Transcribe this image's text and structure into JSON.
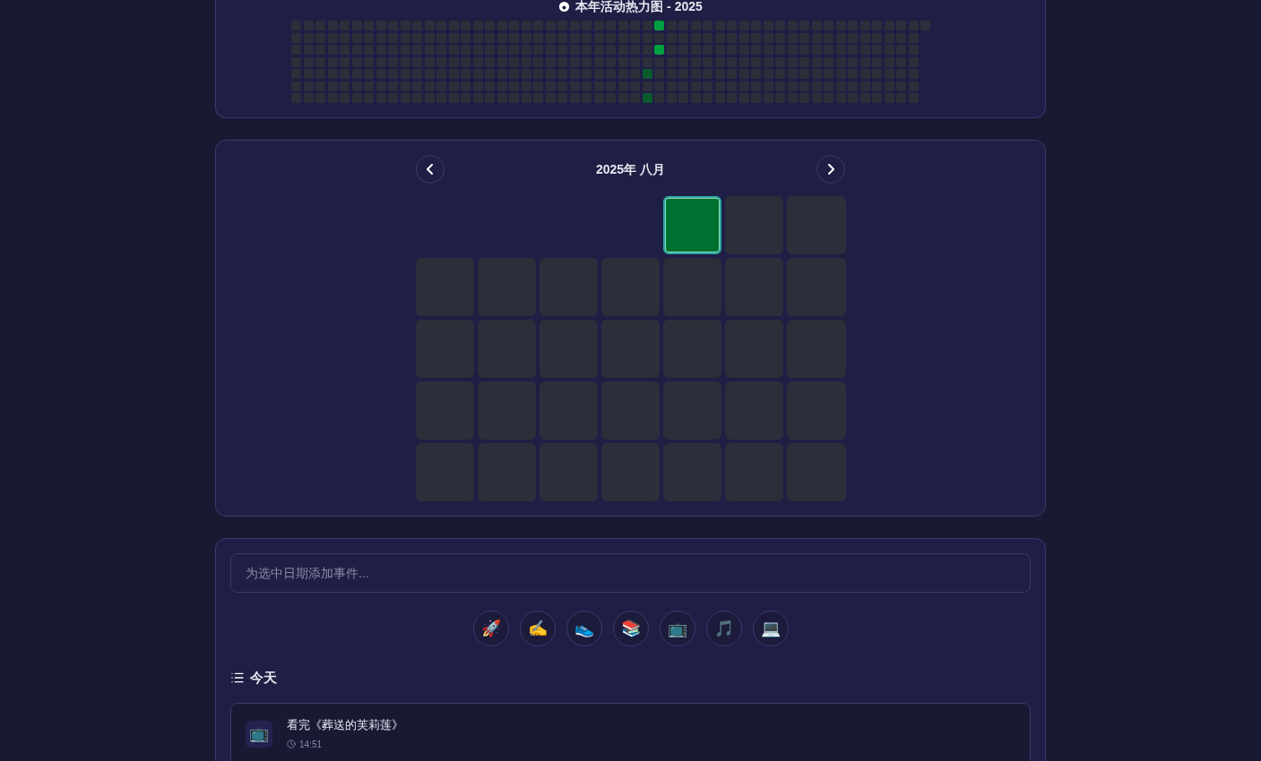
{
  "heatmap": {
    "title": "本年活动热力图 - 2025",
    "weeks": [
      {
        "days": [
          {
            "color": "#2c2f3a"
          },
          {
            "color": "#2c2f3a"
          },
          {
            "color": "#2c2f3a"
          },
          {
            "color": "#2c2f3a"
          },
          {
            "color": "#2c2f3a"
          },
          {
            "color": "#2c2f3a"
          },
          {
            "color": "#2c2f3a"
          }
        ]
      },
      {
        "days": [
          {
            "color": "#2c2f3a"
          },
          {
            "color": "#2c2f3a"
          },
          {
            "color": "#2c2f3a"
          },
          {
            "color": "#2c2f3a"
          },
          {
            "color": "#2c2f3a"
          },
          {
            "color": "#2c2f3a"
          },
          {
            "color": "#2c2f3a"
          }
        ]
      },
      {
        "days": [
          {
            "color": "#2c2f3a"
          },
          {
            "color": "#2c2f3a"
          },
          {
            "color": "#2c2f3a"
          },
          {
            "color": "#2c2f3a"
          },
          {
            "color": "#2c2f3a"
          },
          {
            "color": "#2c2f3a"
          },
          {
            "color": "#2c2f3a"
          }
        ]
      },
      {
        "days": [
          {
            "color": "#2c2f3a"
          },
          {
            "color": "#2c2f3a"
          },
          {
            "color": "#2c2f3a"
          },
          {
            "color": "#2c2f3a"
          },
          {
            "color": "#2c2f3a"
          },
          {
            "color": "#2c2f3a"
          },
          {
            "color": "#2c2f3a"
          }
        ]
      },
      {
        "days": [
          {
            "color": "#2c2f3a"
          },
          {
            "color": "#2c2f3a"
          },
          {
            "color": "#2c2f3a"
          },
          {
            "color": "#2c2f3a"
          },
          {
            "color": "#2c2f3a"
          },
          {
            "color": "#2c2f3a"
          },
          {
            "color": "#2c2f3a"
          }
        ]
      },
      {
        "days": [
          {
            "color": "#2c2f3a"
          },
          {
            "color": "#2c2f3a"
          },
          {
            "color": "#2c2f3a"
          },
          {
            "color": "#2c2f3a"
          },
          {
            "color": "#2c2f3a"
          },
          {
            "color": "#2c2f3a"
          },
          {
            "color": "#2c2f3a"
          }
        ]
      },
      {
        "days": [
          {
            "color": "#2c2f3a"
          },
          {
            "color": "#2c2f3a"
          },
          {
            "color": "#2c2f3a"
          },
          {
            "color": "#2c2f3a"
          },
          {
            "color": "#2c2f3a"
          },
          {
            "color": "#2c2f3a"
          },
          {
            "color": "#2c2f3a"
          }
        ]
      },
      {
        "days": [
          {
            "color": "#2c2f3a"
          },
          {
            "color": "#2c2f3a"
          },
          {
            "color": "#2c2f3a"
          },
          {
            "color": "#2c2f3a"
          },
          {
            "color": "#2c2f3a"
          },
          {
            "color": "#2c2f3a"
          },
          {
            "color": "#2c2f3a"
          }
        ]
      },
      {
        "days": [
          {
            "color": "#2c2f3a"
          },
          {
            "color": "#2c2f3a"
          },
          {
            "color": "#2c2f3a"
          },
          {
            "color": "#2c2f3a"
          },
          {
            "color": "#2c2f3a"
          },
          {
            "color": "#2c2f3a"
          },
          {
            "color": "#2c2f3a"
          }
        ]
      },
      {
        "days": [
          {
            "color": "#2c2f3a"
          },
          {
            "color": "#2c2f3a"
          },
          {
            "color": "#2c2f3a"
          },
          {
            "color": "#2c2f3a"
          },
          {
            "color": "#2c2f3a"
          },
          {
            "color": "#2c2f3a"
          },
          {
            "color": "#2c2f3a"
          }
        ]
      },
      {
        "days": [
          {
            "color": "#2c2f3a"
          },
          {
            "color": "#2c2f3a"
          },
          {
            "color": "#2c2f3a"
          },
          {
            "color": "#2c2f3a"
          },
          {
            "color": "#2c2f3a"
          },
          {
            "color": "#2c2f3a"
          },
          {
            "color": "#2c2f3a"
          }
        ]
      },
      {
        "days": [
          {
            "color": "#2c2f3a"
          },
          {
            "color": "#2c2f3a"
          },
          {
            "color": "#2c2f3a"
          },
          {
            "color": "#2c2f3a"
          },
          {
            "color": "#2c2f3a"
          },
          {
            "color": "#2c2f3a"
          },
          {
            "color": "#2c2f3a"
          }
        ]
      },
      {
        "days": [
          {
            "color": "#2c2f3a"
          },
          {
            "color": "#2c2f3a"
          },
          {
            "color": "#2c2f3a"
          },
          {
            "color": "#2c2f3a"
          },
          {
            "color": "#2c2f3a"
          },
          {
            "color": "#2c2f3a"
          },
          {
            "color": "#2c2f3a"
          }
        ]
      },
      {
        "days": [
          {
            "color": "#2c2f3a"
          },
          {
            "color": "#2c2f3a"
          },
          {
            "color": "#2c2f3a"
          },
          {
            "color": "#2c2f3a"
          },
          {
            "color": "#2c2f3a"
          },
          {
            "color": "#2c2f3a"
          },
          {
            "color": "#2c2f3a"
          }
        ]
      },
      {
        "days": [
          {
            "color": "#2c2f3a"
          },
          {
            "color": "#2c2f3a"
          },
          {
            "color": "#2c2f3a"
          },
          {
            "color": "#2c2f3a"
          },
          {
            "color": "#2c2f3a"
          },
          {
            "color": "#2c2f3a"
          },
          {
            "color": "#2c2f3a"
          }
        ]
      },
      {
        "days": [
          {
            "color": "#2c2f3a"
          },
          {
            "color": "#2c2f3a"
          },
          {
            "color": "#2c2f3a"
          },
          {
            "color": "#2c2f3a"
          },
          {
            "color": "#2c2f3a"
          },
          {
            "color": "#2c2f3a"
          },
          {
            "color": "#2c2f3a"
          }
        ]
      },
      {
        "days": [
          {
            "color": "#2c2f3a"
          },
          {
            "color": "#2c2f3a"
          },
          {
            "color": "#2c2f3a"
          },
          {
            "color": "#2c2f3a"
          },
          {
            "color": "#2c2f3a"
          },
          {
            "color": "#2c2f3a"
          },
          {
            "color": "#2c2f3a"
          }
        ]
      },
      {
        "days": [
          {
            "color": "#2c2f3a"
          },
          {
            "color": "#2c2f3a"
          },
          {
            "color": "#2c2f3a"
          },
          {
            "color": "#2c2f3a"
          },
          {
            "color": "#2c2f3a"
          },
          {
            "color": "#2c2f3a"
          },
          {
            "color": "#2c2f3a"
          }
        ]
      },
      {
        "days": [
          {
            "color": "#2c2f3a"
          },
          {
            "color": "#2c2f3a"
          },
          {
            "color": "#2c2f3a"
          },
          {
            "color": "#2c2f3a"
          },
          {
            "color": "#2c2f3a"
          },
          {
            "color": "#2c2f3a"
          },
          {
            "color": "#2c2f3a"
          }
        ]
      },
      {
        "days": [
          {
            "color": "#2c2f3a"
          },
          {
            "color": "#2c2f3a"
          },
          {
            "color": "#2c2f3a"
          },
          {
            "color": "#2c2f3a"
          },
          {
            "color": "#2c2f3a"
          },
          {
            "color": "#2c2f3a"
          },
          {
            "color": "#2c2f3a"
          }
        ]
      },
      {
        "days": [
          {
            "color": "#2c2f3a"
          },
          {
            "color": "#2c2f3a"
          },
          {
            "color": "#2c2f3a"
          },
          {
            "color": "#2c2f3a"
          },
          {
            "color": "#2c2f3a"
          },
          {
            "color": "#2c2f3a"
          },
          {
            "color": "#2c2f3a"
          }
        ]
      },
      {
        "days": [
          {
            "color": "#2c2f3a"
          },
          {
            "color": "#2c2f3a"
          },
          {
            "color": "#2c2f3a"
          },
          {
            "color": "#2c2f3a"
          },
          {
            "color": "#2c2f3a"
          },
          {
            "color": "#2c2f3a"
          },
          {
            "color": "#2c2f3a"
          }
        ]
      },
      {
        "days": [
          {
            "color": "#2c2f3a"
          },
          {
            "color": "#2c2f3a"
          },
          {
            "color": "#2c2f3a"
          },
          {
            "color": "#2c2f3a"
          },
          {
            "color": "#2c2f3a"
          },
          {
            "color": "#2c2f3a"
          },
          {
            "color": "#2c2f3a"
          }
        ]
      },
      {
        "days": [
          {
            "color": "#2c2f3a"
          },
          {
            "color": "#2c2f3a"
          },
          {
            "color": "#2c2f3a"
          },
          {
            "color": "#2c2f3a"
          },
          {
            "color": "#2c2f3a"
          },
          {
            "color": "#2c2f3a"
          },
          {
            "color": "#2c2f3a"
          }
        ]
      },
      {
        "days": [
          {
            "color": "#2c2f3a"
          },
          {
            "color": "#2c2f3a"
          },
          {
            "color": "#2c2f3a"
          },
          {
            "color": "#2c2f3a"
          },
          {
            "color": "#2c2f3a"
          },
          {
            "color": "#2c2f3a"
          },
          {
            "color": "#2c2f3a"
          }
        ]
      },
      {
        "days": [
          {
            "color": "#2c2f3a"
          },
          {
            "color": "#2c2f3a"
          },
          {
            "color": "#2c2f3a"
          },
          {
            "color": "#2c2f3a"
          },
          {
            "color": "#2c2f3a"
          },
          {
            "color": "#2c2f3a"
          },
          {
            "color": "#2c2f3a"
          }
        ]
      },
      {
        "days": [
          {
            "color": "#2c2f3a"
          },
          {
            "color": "#2c2f3a"
          },
          {
            "color": "#2c2f3a"
          },
          {
            "color": "#2c2f3a"
          },
          {
            "color": "#2c2f3a"
          },
          {
            "color": "#2c2f3a"
          },
          {
            "color": "#2c2f3a"
          }
        ]
      },
      {
        "days": [
          {
            "color": "#2c2f3a"
          },
          {
            "color": "#2c2f3a"
          },
          {
            "color": "#2c2f3a"
          },
          {
            "color": "#2c2f3a"
          },
          {
            "color": "#2c2f3a"
          },
          {
            "color": "#2c2f3a"
          },
          {
            "color": "#2c2f3a"
          }
        ]
      },
      {
        "days": [
          {
            "color": "#2c2f3a"
          },
          {
            "color": "#2c2f3a"
          },
          {
            "color": "#2c2f3a"
          },
          {
            "color": "#2c2f3a"
          },
          {
            "color": "#2c2f3a"
          },
          {
            "color": "#2c2f3a"
          },
          {
            "color": "#2c2f3a"
          }
        ]
      },
      {
        "days": [
          {
            "color": "#2c2f3a"
          },
          {
            "color": "#2c2f3a"
          },
          {
            "color": "#2c2f3a"
          },
          {
            "color": "#2c2f3a"
          },
          {
            "color": "#0b5a2e"
          },
          {
            "color": "#2c2f3a"
          },
          {
            "color": "#0b5a2e"
          }
        ]
      },
      {
        "days": [
          {
            "color": "#00a040"
          },
          {
            "color": "#2c2f3a"
          },
          {
            "color": "#00a040"
          },
          {
            "color": "#2c2f3a"
          },
          {
            "color": "#2c2f3a"
          },
          {
            "color": "#2c2f3a"
          },
          {
            "color": "#2c2f3a"
          }
        ]
      },
      {
        "days": [
          {
            "color": "#2c2f3a"
          },
          {
            "color": "#2c2f3a"
          },
          {
            "color": "#2c2f3a"
          },
          {
            "color": "#2c2f3a"
          },
          {
            "color": "#2c2f3a"
          },
          {
            "color": "#2c2f3a"
          },
          {
            "color": "#2c2f3a"
          }
        ]
      },
      {
        "days": [
          {
            "color": "#2c2f3a"
          },
          {
            "color": "#2c2f3a"
          },
          {
            "color": "#2c2f3a"
          },
          {
            "color": "#2c2f3a"
          },
          {
            "color": "#2c2f3a"
          },
          {
            "color": "#2c2f3a"
          },
          {
            "color": "#2c2f3a"
          }
        ]
      },
      {
        "days": [
          {
            "color": "#2c2f3a"
          },
          {
            "color": "#2c2f3a"
          },
          {
            "color": "#2c2f3a"
          },
          {
            "color": "#2c2f3a"
          },
          {
            "color": "#2c2f3a"
          },
          {
            "color": "#2c2f3a"
          },
          {
            "color": "#2c2f3a"
          }
        ]
      },
      {
        "days": [
          {
            "color": "#2c2f3a"
          },
          {
            "color": "#2c2f3a"
          },
          {
            "color": "#2c2f3a"
          },
          {
            "color": "#2c2f3a"
          },
          {
            "color": "#2c2f3a"
          },
          {
            "color": "#2c2f3a"
          },
          {
            "color": "#2c2f3a"
          }
        ]
      },
      {
        "days": [
          {
            "color": "#2c2f3a"
          },
          {
            "color": "#2c2f3a"
          },
          {
            "color": "#2c2f3a"
          },
          {
            "color": "#2c2f3a"
          },
          {
            "color": "#2c2f3a"
          },
          {
            "color": "#2c2f3a"
          },
          {
            "color": "#2c2f3a"
          }
        ]
      },
      {
        "days": [
          {
            "color": "#2c2f3a"
          },
          {
            "color": "#2c2f3a"
          },
          {
            "color": "#2c2f3a"
          },
          {
            "color": "#2c2f3a"
          },
          {
            "color": "#2c2f3a"
          },
          {
            "color": "#2c2f3a"
          },
          {
            "color": "#2c2f3a"
          }
        ]
      },
      {
        "days": [
          {
            "color": "#2c2f3a"
          },
          {
            "color": "#2c2f3a"
          },
          {
            "color": "#2c2f3a"
          },
          {
            "color": "#2c2f3a"
          },
          {
            "color": "#2c2f3a"
          },
          {
            "color": "#2c2f3a"
          },
          {
            "color": "#2c2f3a"
          }
        ]
      },
      {
        "days": [
          {
            "color": "#2c2f3a"
          },
          {
            "color": "#2c2f3a"
          },
          {
            "color": "#2c2f3a"
          },
          {
            "color": "#2c2f3a"
          },
          {
            "color": "#2c2f3a"
          },
          {
            "color": "#2c2f3a"
          },
          {
            "color": "#2c2f3a"
          }
        ]
      },
      {
        "days": [
          {
            "color": "#2c2f3a"
          },
          {
            "color": "#2c2f3a"
          },
          {
            "color": "#2c2f3a"
          },
          {
            "color": "#2c2f3a"
          },
          {
            "color": "#2c2f3a"
          },
          {
            "color": "#2c2f3a"
          },
          {
            "color": "#2c2f3a"
          }
        ]
      },
      {
        "days": [
          {
            "color": "#2c2f3a"
          },
          {
            "color": "#2c2f3a"
          },
          {
            "color": "#2c2f3a"
          },
          {
            "color": "#2c2f3a"
          },
          {
            "color": "#2c2f3a"
          },
          {
            "color": "#2c2f3a"
          },
          {
            "color": "#2c2f3a"
          }
        ]
      },
      {
        "days": [
          {
            "color": "#2c2f3a"
          },
          {
            "color": "#2c2f3a"
          },
          {
            "color": "#2c2f3a"
          },
          {
            "color": "#2c2f3a"
          },
          {
            "color": "#2c2f3a"
          },
          {
            "color": "#2c2f3a"
          },
          {
            "color": "#2c2f3a"
          }
        ]
      },
      {
        "days": [
          {
            "color": "#2c2f3a"
          },
          {
            "color": "#2c2f3a"
          },
          {
            "color": "#2c2f3a"
          },
          {
            "color": "#2c2f3a"
          },
          {
            "color": "#2c2f3a"
          },
          {
            "color": "#2c2f3a"
          },
          {
            "color": "#2c2f3a"
          }
        ]
      },
      {
        "days": [
          {
            "color": "#2c2f3a"
          },
          {
            "color": "#2c2f3a"
          },
          {
            "color": "#2c2f3a"
          },
          {
            "color": "#2c2f3a"
          },
          {
            "color": "#2c2f3a"
          },
          {
            "color": "#2c2f3a"
          },
          {
            "color": "#2c2f3a"
          }
        ]
      },
      {
        "days": [
          {
            "color": "#2c2f3a"
          },
          {
            "color": "#2c2f3a"
          },
          {
            "color": "#2c2f3a"
          },
          {
            "color": "#2c2f3a"
          },
          {
            "color": "#2c2f3a"
          },
          {
            "color": "#2c2f3a"
          },
          {
            "color": "#2c2f3a"
          }
        ]
      },
      {
        "days": [
          {
            "color": "#2c2f3a"
          },
          {
            "color": "#2c2f3a"
          },
          {
            "color": "#2c2f3a"
          },
          {
            "color": "#2c2f3a"
          },
          {
            "color": "#2c2f3a"
          },
          {
            "color": "#2c2f3a"
          },
          {
            "color": "#2c2f3a"
          }
        ]
      },
      {
        "days": [
          {
            "color": "#2c2f3a"
          },
          {
            "color": "#2c2f3a"
          },
          {
            "color": "#2c2f3a"
          },
          {
            "color": "#2c2f3a"
          },
          {
            "color": "#2c2f3a"
          },
          {
            "color": "#2c2f3a"
          },
          {
            "color": "#2c2f3a"
          }
        ]
      },
      {
        "days": [
          {
            "color": "#2c2f3a"
          },
          {
            "color": "#2c2f3a"
          },
          {
            "color": "#2c2f3a"
          },
          {
            "color": "#2c2f3a"
          },
          {
            "color": "#2c2f3a"
          },
          {
            "color": "#2c2f3a"
          },
          {
            "color": "#2c2f3a"
          }
        ]
      },
      {
        "days": [
          {
            "color": "#2c2f3a"
          },
          {
            "color": "#2c2f3a"
          },
          {
            "color": "#2c2f3a"
          },
          {
            "color": "#2c2f3a"
          },
          {
            "color": "#2c2f3a"
          },
          {
            "color": "#2c2f3a"
          },
          {
            "color": "#2c2f3a"
          }
        ]
      },
      {
        "days": [
          {
            "color": "#2c2f3a"
          },
          {
            "color": "#2c2f3a"
          },
          {
            "color": "#2c2f3a"
          },
          {
            "color": "#2c2f3a"
          },
          {
            "color": "#2c2f3a"
          },
          {
            "color": "#2c2f3a"
          },
          {
            "color": "#2c2f3a"
          }
        ]
      },
      {
        "days": [
          {
            "color": "#2c2f3a"
          },
          {
            "color": "#2c2f3a"
          },
          {
            "color": "#2c2f3a"
          },
          {
            "color": "#2c2f3a"
          },
          {
            "color": "#2c2f3a"
          },
          {
            "color": "#2c2f3a"
          },
          {
            "color": "#2c2f3a"
          }
        ]
      },
      {
        "days": [
          {
            "color": "#2c2f3a"
          },
          {
            "color": "#2c2f3a"
          },
          {
            "color": "#2c2f3a"
          },
          {
            "color": "#2c2f3a"
          },
          {
            "color": "#2c2f3a"
          },
          {
            "color": "#2c2f3a"
          },
          {
            "color": "#2c2f3a"
          }
        ]
      },
      {
        "days": [
          {
            "color": "#2c2f3a"
          }
        ]
      }
    ]
  },
  "calendar": {
    "title": "2025年 八月",
    "days": [
      {
        "kind": "blank"
      },
      {
        "kind": "blank"
      },
      {
        "kind": "blank"
      },
      {
        "kind": "blank"
      },
      {
        "kind": "day",
        "color": "#007030",
        "selected": true
      },
      {
        "kind": "day",
        "color": "#2c2f3a",
        "selected": false
      },
      {
        "kind": "day",
        "color": "#2c2f3a",
        "selected": false
      },
      {
        "kind": "day",
        "color": "#2c2f3a",
        "selected": false
      },
      {
        "kind": "day",
        "color": "#2c2f3a",
        "selected": false
      },
      {
        "kind": "day",
        "color": "#2c2f3a",
        "selected": false
      },
      {
        "kind": "day",
        "color": "#2c2f3a",
        "selected": false
      },
      {
        "kind": "day",
        "color": "#2c2f3a",
        "selected": false
      },
      {
        "kind": "day",
        "color": "#2c2f3a",
        "selected": false
      },
      {
        "kind": "day",
        "color": "#2c2f3a",
        "selected": false
      },
      {
        "kind": "day",
        "color": "#2c2f3a",
        "selected": false
      },
      {
        "kind": "day",
        "color": "#2c2f3a",
        "selected": false
      },
      {
        "kind": "day",
        "color": "#2c2f3a",
        "selected": false
      },
      {
        "kind": "day",
        "color": "#2c2f3a",
        "selected": false
      },
      {
        "kind": "day",
        "color": "#2c2f3a",
        "selected": false
      },
      {
        "kind": "day",
        "color": "#2c2f3a",
        "selected": false
      },
      {
        "kind": "day",
        "color": "#2c2f3a",
        "selected": false
      },
      {
        "kind": "day",
        "color": "#2c2f3a",
        "selected": false
      },
      {
        "kind": "day",
        "color": "#2c2f3a",
        "selected": false
      },
      {
        "kind": "day",
        "color": "#2c2f3a",
        "selected": false
      },
      {
        "kind": "day",
        "color": "#2c2f3a",
        "selected": false
      },
      {
        "kind": "day",
        "color": "#2c2f3a",
        "selected": false
      },
      {
        "kind": "day",
        "color": "#2c2f3a",
        "selected": false
      },
      {
        "kind": "day",
        "color": "#2c2f3a",
        "selected": false
      },
      {
        "kind": "day",
        "color": "#2c2f3a",
        "selected": false
      },
      {
        "kind": "day",
        "color": "#2c2f3a",
        "selected": false
      },
      {
        "kind": "day",
        "color": "#2c2f3a",
        "selected": false
      },
      {
        "kind": "day",
        "color": "#2c2f3a",
        "selected": false
      },
      {
        "kind": "day",
        "color": "#2c2f3a",
        "selected": false
      },
      {
        "kind": "day",
        "color": "#2c2f3a",
        "selected": false
      },
      {
        "kind": "day",
        "color": "#2c2f3a",
        "selected": false
      }
    ]
  },
  "event_form": {
    "placeholder": "为选中日期添加事件...",
    "emojis": [
      "🚀",
      "✍️",
      "👟",
      "📚",
      "📺",
      "🎵",
      "💻"
    ]
  },
  "today": {
    "title": "今天",
    "events": [
      {
        "emoji": "📺",
        "title": "看完《葬送的芙莉莲》",
        "time": "14:51"
      }
    ]
  }
}
